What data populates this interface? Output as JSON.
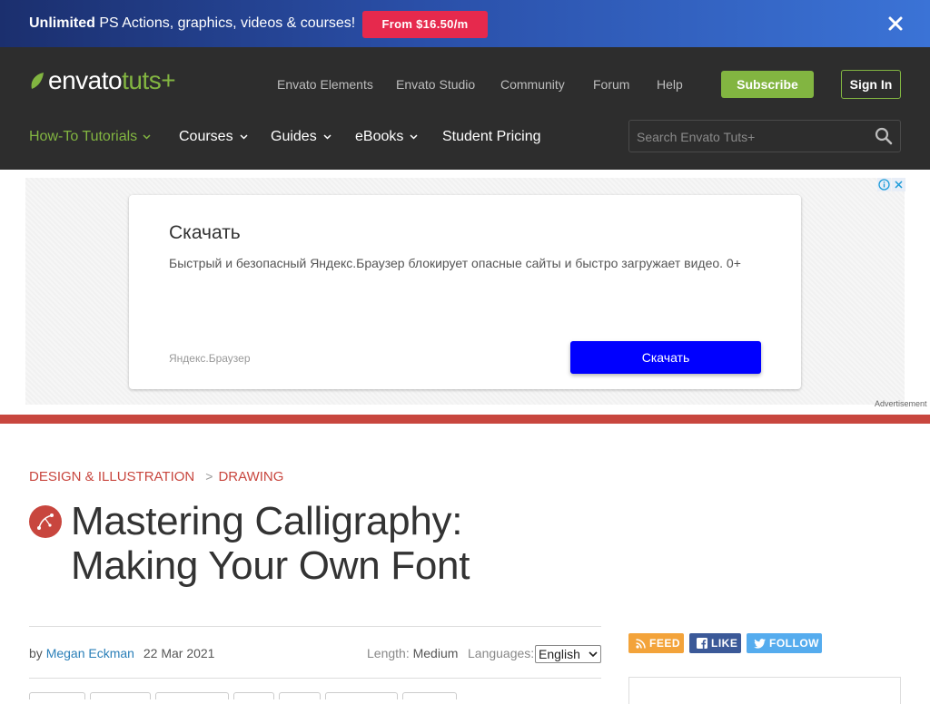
{
  "promo": {
    "text_strong": "Unlimited",
    "text_rest": " PS Actions, graphics, videos & courses!",
    "cta": "From $16.50/m"
  },
  "header": {
    "logo_a": "envato",
    "logo_b": "tuts+",
    "top_nav": [
      "Envato Elements",
      "Envato Studio",
      "Community",
      "Forum",
      "Help"
    ],
    "subscribe": "Subscribe",
    "signin": "Sign In",
    "main_nav": [
      "How-To Tutorials",
      "Courses",
      "Guides",
      "eBooks",
      "Student Pricing"
    ],
    "search_placeholder": "Search Envato Tuts+"
  },
  "ad": {
    "title": "Скачать",
    "description": "Быстрый и безопасный Яндекс.Браузер блокирует опасные сайты и быстро загружает видео. 0+",
    "brand": "Яндекс.Браузер",
    "cta": "Скачать",
    "label": "Advertisement"
  },
  "article": {
    "breadcrumb": [
      "DESIGN & ILLUSTRATION",
      "DRAWING"
    ],
    "breadcrumb_sep": ">",
    "title": "Mastering Calligraphy: Making Your Own Font",
    "by": "by",
    "author": "Megan Eckman",
    "date": "22 Mar 2021",
    "length_label": "Length:",
    "length_value": "Medium",
    "languages_label": "Languages:",
    "language_selected": "English"
  },
  "social": {
    "feed": "FEED",
    "like": "LIKE",
    "follow": "FOLLOW"
  },
  "colors": {
    "accent_green": "#82b541",
    "accent_red": "#c8463e",
    "feed": "#f3a33a",
    "like": "#3b5998",
    "follow": "#55acee",
    "ad_cta": "#0000ff"
  }
}
